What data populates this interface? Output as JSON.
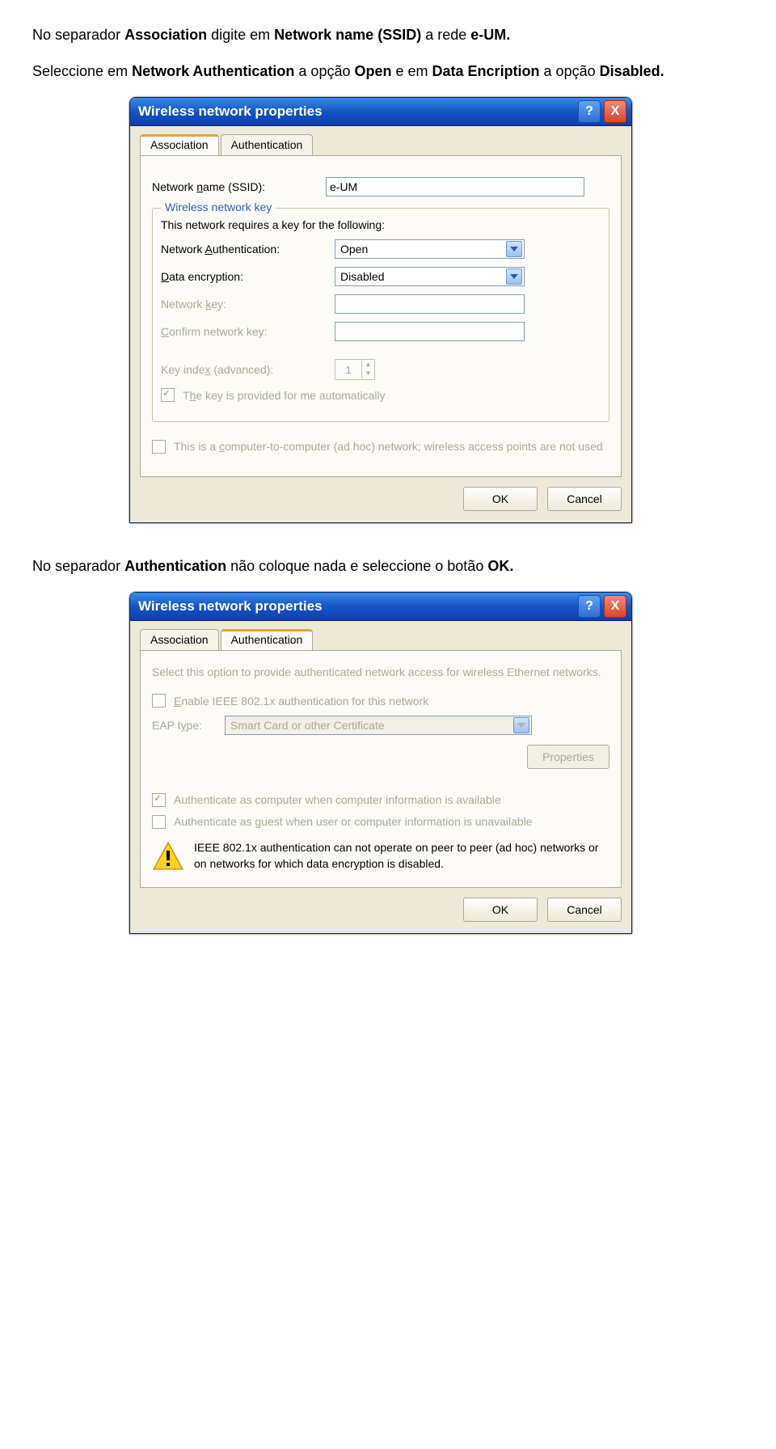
{
  "intro1": {
    "t1": "No separador ",
    "b1": "Association",
    "t2": " digite em ",
    "b2": "Network name (SSID)",
    "t3": " a rede ",
    "b3": "e-UM."
  },
  "intro2": {
    "t1": "Seleccione em ",
    "b1": "Network Authentication",
    "t2": " a opção ",
    "b2": "Open",
    "t3": " e em ",
    "b3": "Data Encription",
    "t4": " a opção ",
    "b4": "Disabled."
  },
  "intro3": {
    "t1": "No separador ",
    "b1": "Authentication",
    "t2": " não coloque nada e seleccione o botão ",
    "b2": "OK."
  },
  "win": {
    "title": "Wireless network properties",
    "help": "?",
    "close": "X",
    "tabs": {
      "assoc": "Association",
      "auth": "Authentication"
    },
    "assoc": {
      "ssid_label_pre": "Network ",
      "ssid_label_u": "n",
      "ssid_label_post": "ame (SSID):",
      "ssid_value": "e-UM",
      "group": "Wireless network key",
      "group_text": "This network requires a key for the following:",
      "auth_pre": "Network ",
      "auth_u": "A",
      "auth_post": "uthentication:",
      "auth_val": "Open",
      "enc_u": "D",
      "enc_post": "ata encryption:",
      "enc_val": "Disabled",
      "key_pre": "Network ",
      "key_u": "k",
      "key_post": "ey:",
      "confirm_u": "C",
      "confirm_post": "onfirm network key:",
      "idx_pre": "Key inde",
      "idx_u": "x",
      "idx_post": " (advanced):",
      "idx_val": "1",
      "auto_pre": "T",
      "auto_u": "h",
      "auto_post": "e key is provided for me automatically",
      "adhoc_pre": "This is a ",
      "adhoc_u": "c",
      "adhoc_post": "omputer-to-computer (ad hoc) network; wireless access points are not used",
      "ok": "OK",
      "cancel": "Cancel"
    },
    "auth": {
      "intro": "Select this option to provide authenticated network access for wireless Ethernet networks.",
      "enable_u": "E",
      "enable_post": "nable IEEE 802.1x authentication for this network",
      "eap_pre": "EAP t",
      "eap_u": "y",
      "eap_post": "pe:",
      "eap_val": "Smart Card or other Certificate",
      "props": "Properties",
      "comp": "Authenticate as computer when computer information is available",
      "guest": "Authenticate as guest when user or computer information is unavailable",
      "warn": "IEEE 802.1x authentication can not operate on peer to peer (ad hoc) networks or on networks for which data encryption is disabled.",
      "ok": "OK",
      "cancel": "Cancel"
    }
  }
}
